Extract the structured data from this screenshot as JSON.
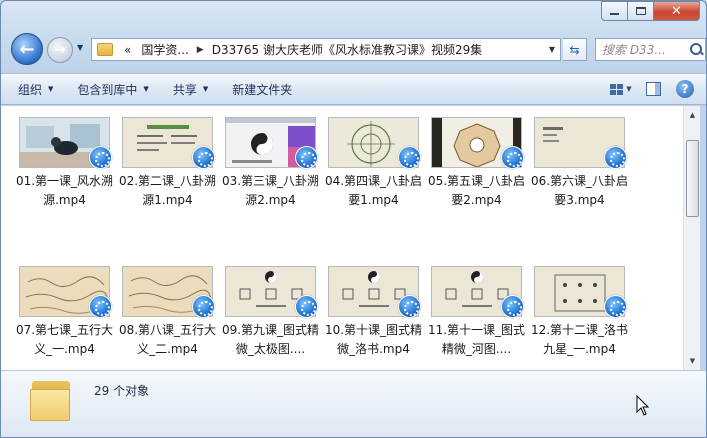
{
  "window": {
    "min_label": "0",
    "max_label": "1",
    "close_label": "x"
  },
  "nav": {
    "back_label": "←",
    "fwd_label": "→",
    "address_prefix": "«",
    "address_segment1": "国学资...",
    "address_segment2": "D33765 谢大庆老师《风水标准教习课》视频29集",
    "search_placeholder": "搜索 D33..."
  },
  "toolbar": {
    "organize": "组织",
    "include_library": "包含到库中",
    "share": "共享",
    "new_folder": "新建文件夹"
  },
  "files": [
    {
      "label": "01.第一课_风水溯源.mp4",
      "thumb": "photo"
    },
    {
      "label": "02.第二课_八卦溯源1.mp4",
      "thumb": "board-title"
    },
    {
      "label": "03.第三课_八卦溯源2.mp4",
      "thumb": "yinyang-slide"
    },
    {
      "label": "04.第四课_八卦启要1.mp4",
      "thumb": "circle-diagram"
    },
    {
      "label": "05.第五课_八卦启要2.mp4",
      "thumb": "bagua"
    },
    {
      "label": "06.第六课_八卦启要3.mp4",
      "thumb": "board-text"
    },
    {
      "label": "07.第七课_五行大义_一.mp4",
      "thumb": "scroll"
    },
    {
      "label": "08.第八课_五行大义_二.mp4",
      "thumb": "scroll"
    },
    {
      "label": "09.第九课_图式精微_太极图....",
      "thumb": "taiji-board"
    },
    {
      "label": "10.第十课_图式精微_洛书.mp4",
      "thumb": "taiji-board"
    },
    {
      "label": "11.第十一课_图式精微_河图....",
      "thumb": "taiji-board"
    },
    {
      "label": "12.第十二课_洛书九星_一.mp4",
      "thumb": "luoshu-board"
    }
  ],
  "status": {
    "count_text": "29 个对象"
  },
  "colors": {
    "accent": "#1164c8",
    "board": "#ebe7d8"
  }
}
